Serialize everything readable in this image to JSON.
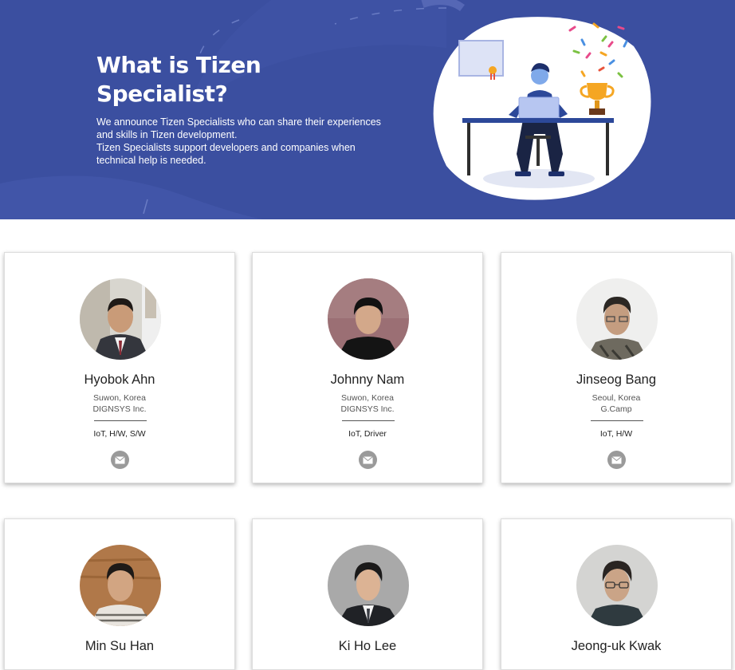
{
  "hero": {
    "title_line1": "What is Tizen",
    "title_line2": "Specialist?",
    "desc_line1": "We announce Tizen Specialists who can share their experiences and skills in Tizen development.",
    "desc_line2": "Tizen Specialists support developers and companies when technical help is needed."
  },
  "specialists": [
    {
      "name": "Hyobok Ahn",
      "location": "Suwon, Korea",
      "company": "DIGNSYS Inc.",
      "tags": "IoT, H/W, S/W"
    },
    {
      "name": "Johnny Nam",
      "location": "Suwon, Korea",
      "company": "DIGNSYS Inc.",
      "tags": "IoT, Driver"
    },
    {
      "name": "Jinseog Bang",
      "location": "Seoul, Korea",
      "company": "G.Camp",
      "tags": "IoT, H/W"
    },
    {
      "name": "Min Su Han"
    },
    {
      "name": "Ki Ho Lee"
    },
    {
      "name": "Jeong-uk Kwak"
    }
  ],
  "colors": {
    "hero_bg": "#3b4fa0",
    "mail_icon": "#9a9a9a"
  },
  "icons": {
    "contact": "mail-icon"
  }
}
